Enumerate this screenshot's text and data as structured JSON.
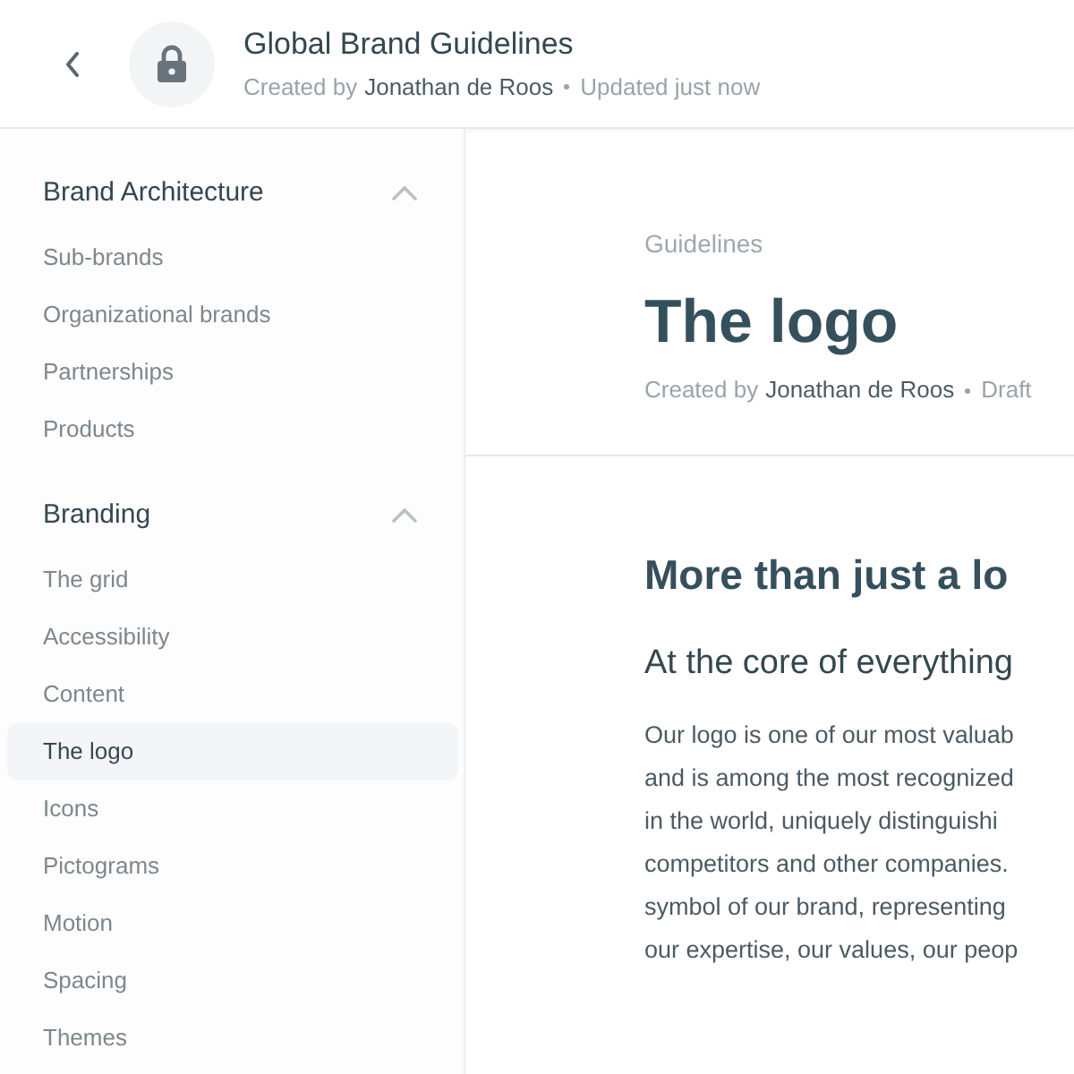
{
  "header": {
    "title": "Global Brand Guidelines",
    "created_by_label": "Created by",
    "author": "Jonathan de Roos",
    "status": "Updated just now"
  },
  "sidebar": {
    "sections": [
      {
        "title": "Brand Architecture",
        "expanded": true,
        "items": [
          {
            "label": "Sub-brands",
            "selected": false
          },
          {
            "label": "Organizational brands",
            "selected": false
          },
          {
            "label": "Partnerships",
            "selected": false
          },
          {
            "label": "Products",
            "selected": false
          }
        ]
      },
      {
        "title": "Branding",
        "expanded": true,
        "items": [
          {
            "label": "The grid",
            "selected": false
          },
          {
            "label": "Accessibility",
            "selected": false
          },
          {
            "label": "Content",
            "selected": false
          },
          {
            "label": "The logo",
            "selected": true
          },
          {
            "label": "Icons",
            "selected": false
          },
          {
            "label": "Pictograms",
            "selected": false
          },
          {
            "label": "Motion",
            "selected": false
          },
          {
            "label": "Spacing",
            "selected": false
          },
          {
            "label": "Themes",
            "selected": false
          }
        ]
      }
    ]
  },
  "page": {
    "breadcrumb": "Guidelines",
    "title": "The logo",
    "created_by_label": "Created by",
    "author": "Jonathan de Roos",
    "status": "Draft",
    "heading": "More than just a lo",
    "subheading": "At the core of everything",
    "body_lines": [
      "Our logo is one of our most valuab",
      "and is among the most recognized",
      "in the world, uniquely distinguishi",
      "competitors and other companies.",
      "symbol of our brand, representing",
      "our expertise, our values, our peop"
    ]
  }
}
